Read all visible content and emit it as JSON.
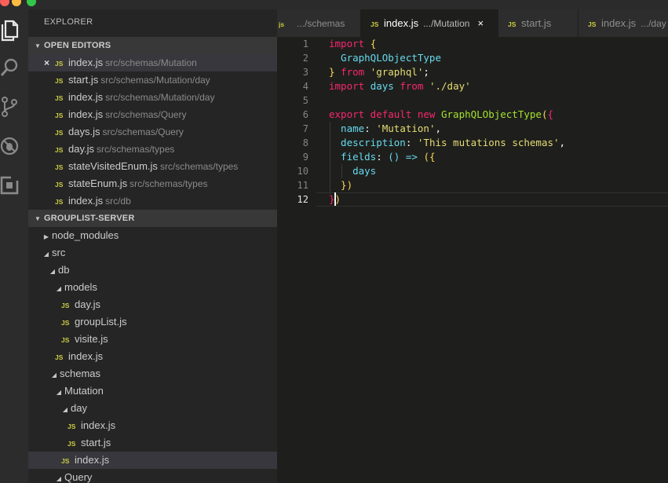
{
  "window": {
    "traffic_lights": [
      "close",
      "minimize",
      "zoom"
    ]
  },
  "activity_bar": {
    "icons": [
      "files-icon",
      "search-icon",
      "source-control-icon",
      "debug-icon",
      "extensions-icon"
    ]
  },
  "sidebar": {
    "title": "EXPLORER",
    "open_editors": {
      "header": "OPEN EDITORS",
      "items": [
        {
          "close": "×",
          "badge": "JS",
          "name": "index.js",
          "path": "src/schemas/Mutation"
        },
        {
          "badge": "JS",
          "name": "start.js",
          "path": "src/schemas/Mutation/day"
        },
        {
          "badge": "JS",
          "name": "index.js",
          "path": "src/schemas/Mutation/day"
        },
        {
          "badge": "JS",
          "name": "index.js",
          "path": "src/schemas/Query"
        },
        {
          "badge": "JS",
          "name": "days.js",
          "path": "src/schemas/Query"
        },
        {
          "badge": "JS",
          "name": "day.js",
          "path": "src/schemas/types"
        },
        {
          "badge": "JS",
          "name": "stateVisitedEnum.js",
          "path": "src/schemas/types"
        },
        {
          "badge": "JS",
          "name": "stateEnum.js",
          "path": "src/schemas/types"
        },
        {
          "badge": "JS",
          "name": "index.js",
          "path": "src/db"
        }
      ]
    },
    "project": {
      "header": "GROUPLIST-SERVER",
      "tree": [
        {
          "type": "folder",
          "name": "node_modules",
          "expanded": false
        },
        {
          "type": "folder",
          "name": "src",
          "expanded": true
        },
        {
          "type": "folder",
          "name": "db",
          "expanded": true
        },
        {
          "type": "folder",
          "name": "models",
          "expanded": true
        },
        {
          "type": "file",
          "badge": "JS",
          "name": "day.js"
        },
        {
          "type": "file",
          "badge": "JS",
          "name": "groupList.js"
        },
        {
          "type": "file",
          "badge": "JS",
          "name": "visite.js"
        },
        {
          "type": "file",
          "badge": "JS",
          "name": "index.js"
        },
        {
          "type": "folder",
          "name": "schemas",
          "expanded": true
        },
        {
          "type": "folder",
          "name": "Mutation",
          "expanded": true
        },
        {
          "type": "folder",
          "name": "day",
          "expanded": true
        },
        {
          "type": "file",
          "badge": "JS",
          "name": "index.js"
        },
        {
          "type": "file",
          "badge": "JS",
          "name": "start.js"
        },
        {
          "type": "file",
          "badge": "JS",
          "name": "index.js",
          "selected": true
        },
        {
          "type": "folder",
          "name": "Query",
          "expanded": true
        }
      ]
    }
  },
  "tabs": [
    {
      "badge": "js",
      "name": "",
      "desc": ".../schemas",
      "active": false
    },
    {
      "badge": "JS",
      "name": "index.js",
      "desc": ".../Mutation",
      "active": true,
      "close": "×"
    },
    {
      "badge": "JS",
      "name": "start.js",
      "desc": "",
      "active": false
    },
    {
      "badge": "JS",
      "name": "index.js",
      "desc": ".../day",
      "active": false
    }
  ],
  "editor": {
    "current_line": 12,
    "lines": [
      [
        [
          "import ",
          "#f92672"
        ],
        [
          "{",
          "#fcd658"
        ]
      ],
      [
        [
          "  GraphQLObjectType",
          "#66d9ef"
        ]
      ],
      [
        [
          "}",
          "#fcd658"
        ],
        [
          " from ",
          "#f92672"
        ],
        [
          "'graphql'",
          "#e6db74"
        ],
        [
          ";",
          "#f8f8f2"
        ]
      ],
      [
        [
          "import ",
          "#f92672"
        ],
        [
          "days ",
          "#66d9ef"
        ],
        [
          "from ",
          "#f92672"
        ],
        [
          "'./day'",
          "#e6db74"
        ]
      ],
      [],
      [
        [
          "export default new ",
          "#f92672"
        ],
        [
          "GraphQLObjectType",
          "#a6e22e"
        ],
        [
          "(",
          "#fcd658"
        ],
        [
          "{",
          "#f92672"
        ]
      ],
      [
        [
          "  name",
          "#66d9ef"
        ],
        [
          ": ",
          "#f8f8f2"
        ],
        [
          "'Mutation'",
          "#e6db74"
        ],
        [
          ",",
          "#f8f8f2"
        ]
      ],
      [
        [
          "  description",
          "#66d9ef"
        ],
        [
          ": ",
          "#f8f8f2"
        ],
        [
          "'This mutations schemas'",
          "#e6db74"
        ],
        [
          ",",
          "#f8f8f2"
        ]
      ],
      [
        [
          "  fields",
          "#66d9ef"
        ],
        [
          ": ",
          "#f8f8f2"
        ],
        [
          "() ",
          "#66d9ef"
        ],
        [
          "=> ",
          "#66d9ef"
        ],
        [
          "(",
          "#fcd658"
        ],
        [
          "{",
          "#fcd658"
        ]
      ],
      [
        [
          "    days",
          "#66d9ef"
        ]
      ],
      [
        [
          "  })",
          "#fcd658"
        ]
      ],
      [
        [
          "}",
          "#f92672"
        ],
        [
          ")",
          "#fcd658"
        ]
      ]
    ]
  },
  "colors": {
    "js_badge": "#cbcb41",
    "keyword": "#f92672",
    "string": "#e6db74",
    "identifier": "#66d9ef",
    "class_name": "#a6e22e"
  }
}
